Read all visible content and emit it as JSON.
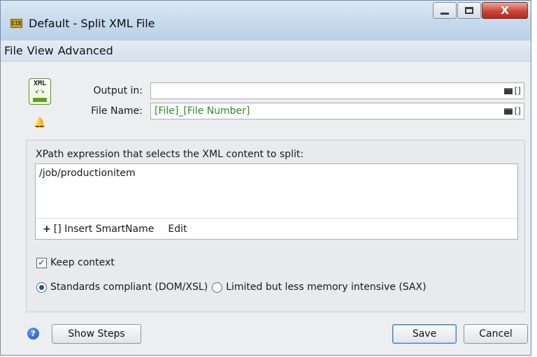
{
  "window": {
    "title": "Default - Split XML File",
    "app_icon_text": "XML",
    "title_icon_text": "EIB"
  },
  "menu": [
    "File",
    "View",
    "Advanced"
  ],
  "fields": {
    "output_label": "Output in:",
    "output_value": "",
    "filename_label": "File Name:",
    "filename_value": "[File]_[File Number]",
    "smartname_glyph": "[]"
  },
  "xpath": {
    "label": "XPath expression that selects the XML content to split:",
    "value": "/job/productionitem",
    "insert_label": "[] Insert SmartName",
    "edit_label": "Edit"
  },
  "options": {
    "keep_context_label": "Keep context",
    "keep_context_checked": true,
    "mode_dom_label": "Standards compliant (DOM/XSL)",
    "mode_sax_label": "Limited but less memory intensive (SAX)",
    "selected_mode": "dom"
  },
  "buttons": {
    "help": "?",
    "show_steps": "Show Steps",
    "save": "Save",
    "cancel": "Cancel",
    "close": "X"
  },
  "icons": [
    "app-xml-icon",
    "bell-icon",
    "folder-icon",
    "smartname-icon",
    "help-icon",
    "checkmark-icon",
    "radio-dot-icon"
  ]
}
